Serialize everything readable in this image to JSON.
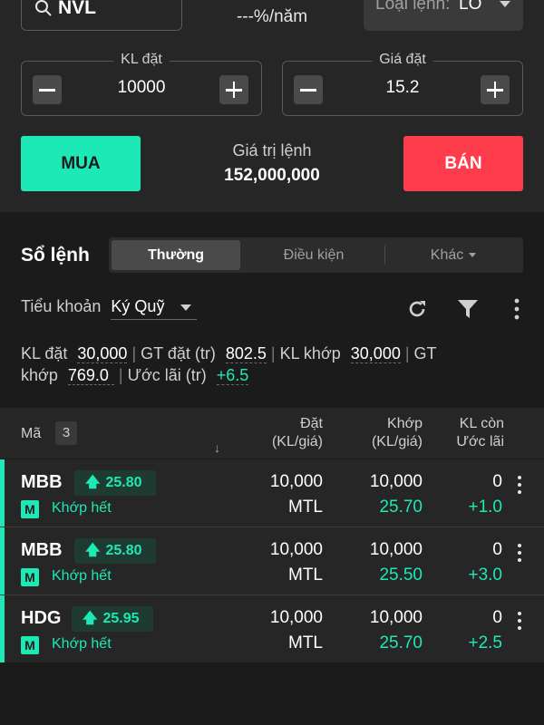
{
  "order_form": {
    "symbol": "NVL",
    "rate_text": "---%/năm",
    "order_type_label": "Loại lệnh:",
    "order_type_value": "LO",
    "quantity": {
      "label": "KL đặt",
      "value": "10000"
    },
    "price": {
      "label": "Giá đặt",
      "value": "15.2"
    },
    "buy_label": "MUA",
    "sell_label": "BÁN",
    "order_value_label": "Giá trị lệnh",
    "order_value": "152,000,000"
  },
  "order_book": {
    "title": "Sổ lệnh",
    "tabs": [
      {
        "label": "Thường",
        "active": true
      },
      {
        "label": "Điều kiện",
        "active": false
      },
      {
        "label": "Khác",
        "active": false
      }
    ],
    "sub_account_label": "Tiểu khoản",
    "sub_account_value": "Ký Quỹ",
    "summary": {
      "kl_dat_label": "KL đặt",
      "kl_dat": "30,000",
      "gt_dat_label": "GT đặt (tr)",
      "gt_dat": "802.5",
      "kl_khop_label": "KL khớp",
      "kl_khop": "30,000",
      "gt_khop_label_a": "GT",
      "gt_khop_label_b": "khớp",
      "gt_khop": "769.0",
      "uoc_lai_label": "Ước lãi (tr)",
      "uoc_lai": "+6.5"
    },
    "table": {
      "col_ma": "Mã",
      "count": "3",
      "sort_arrow": "↓",
      "col_dat_1": "Đặt",
      "col_dat_2": "(KL/giá)",
      "col_khop_1": "Khớp",
      "col_khop_2": "(KL/giá)",
      "col_klcon_1": "KL còn",
      "col_klcon_2": "Ước lãi",
      "rows": [
        {
          "symbol": "MBB",
          "price": "25.80",
          "badge": "M",
          "status": "Khớp hết",
          "dat_kl": "10,000",
          "dat_gia": "MTL",
          "khop_kl": "10,000",
          "khop_gia": "25.70",
          "kl_con": "0",
          "uoc_lai": "+1.0"
        },
        {
          "symbol": "MBB",
          "price": "25.80",
          "badge": "M",
          "status": "Khớp hết",
          "dat_kl": "10,000",
          "dat_gia": "MTL",
          "khop_kl": "10,000",
          "khop_gia": "25.50",
          "kl_con": "0",
          "uoc_lai": "+3.0"
        },
        {
          "symbol": "HDG",
          "price": "25.95",
          "badge": "M",
          "status": "Khớp hết",
          "dat_kl": "10,000",
          "dat_gia": "MTL",
          "khop_kl": "10,000",
          "khop_gia": "25.70",
          "kl_con": "0",
          "uoc_lai": "+2.5"
        }
      ]
    }
  },
  "colors": {
    "accent_green": "#1de9b6",
    "sell_red": "#ff3c4c",
    "panel": "#262626",
    "background": "#1b1b1b"
  }
}
